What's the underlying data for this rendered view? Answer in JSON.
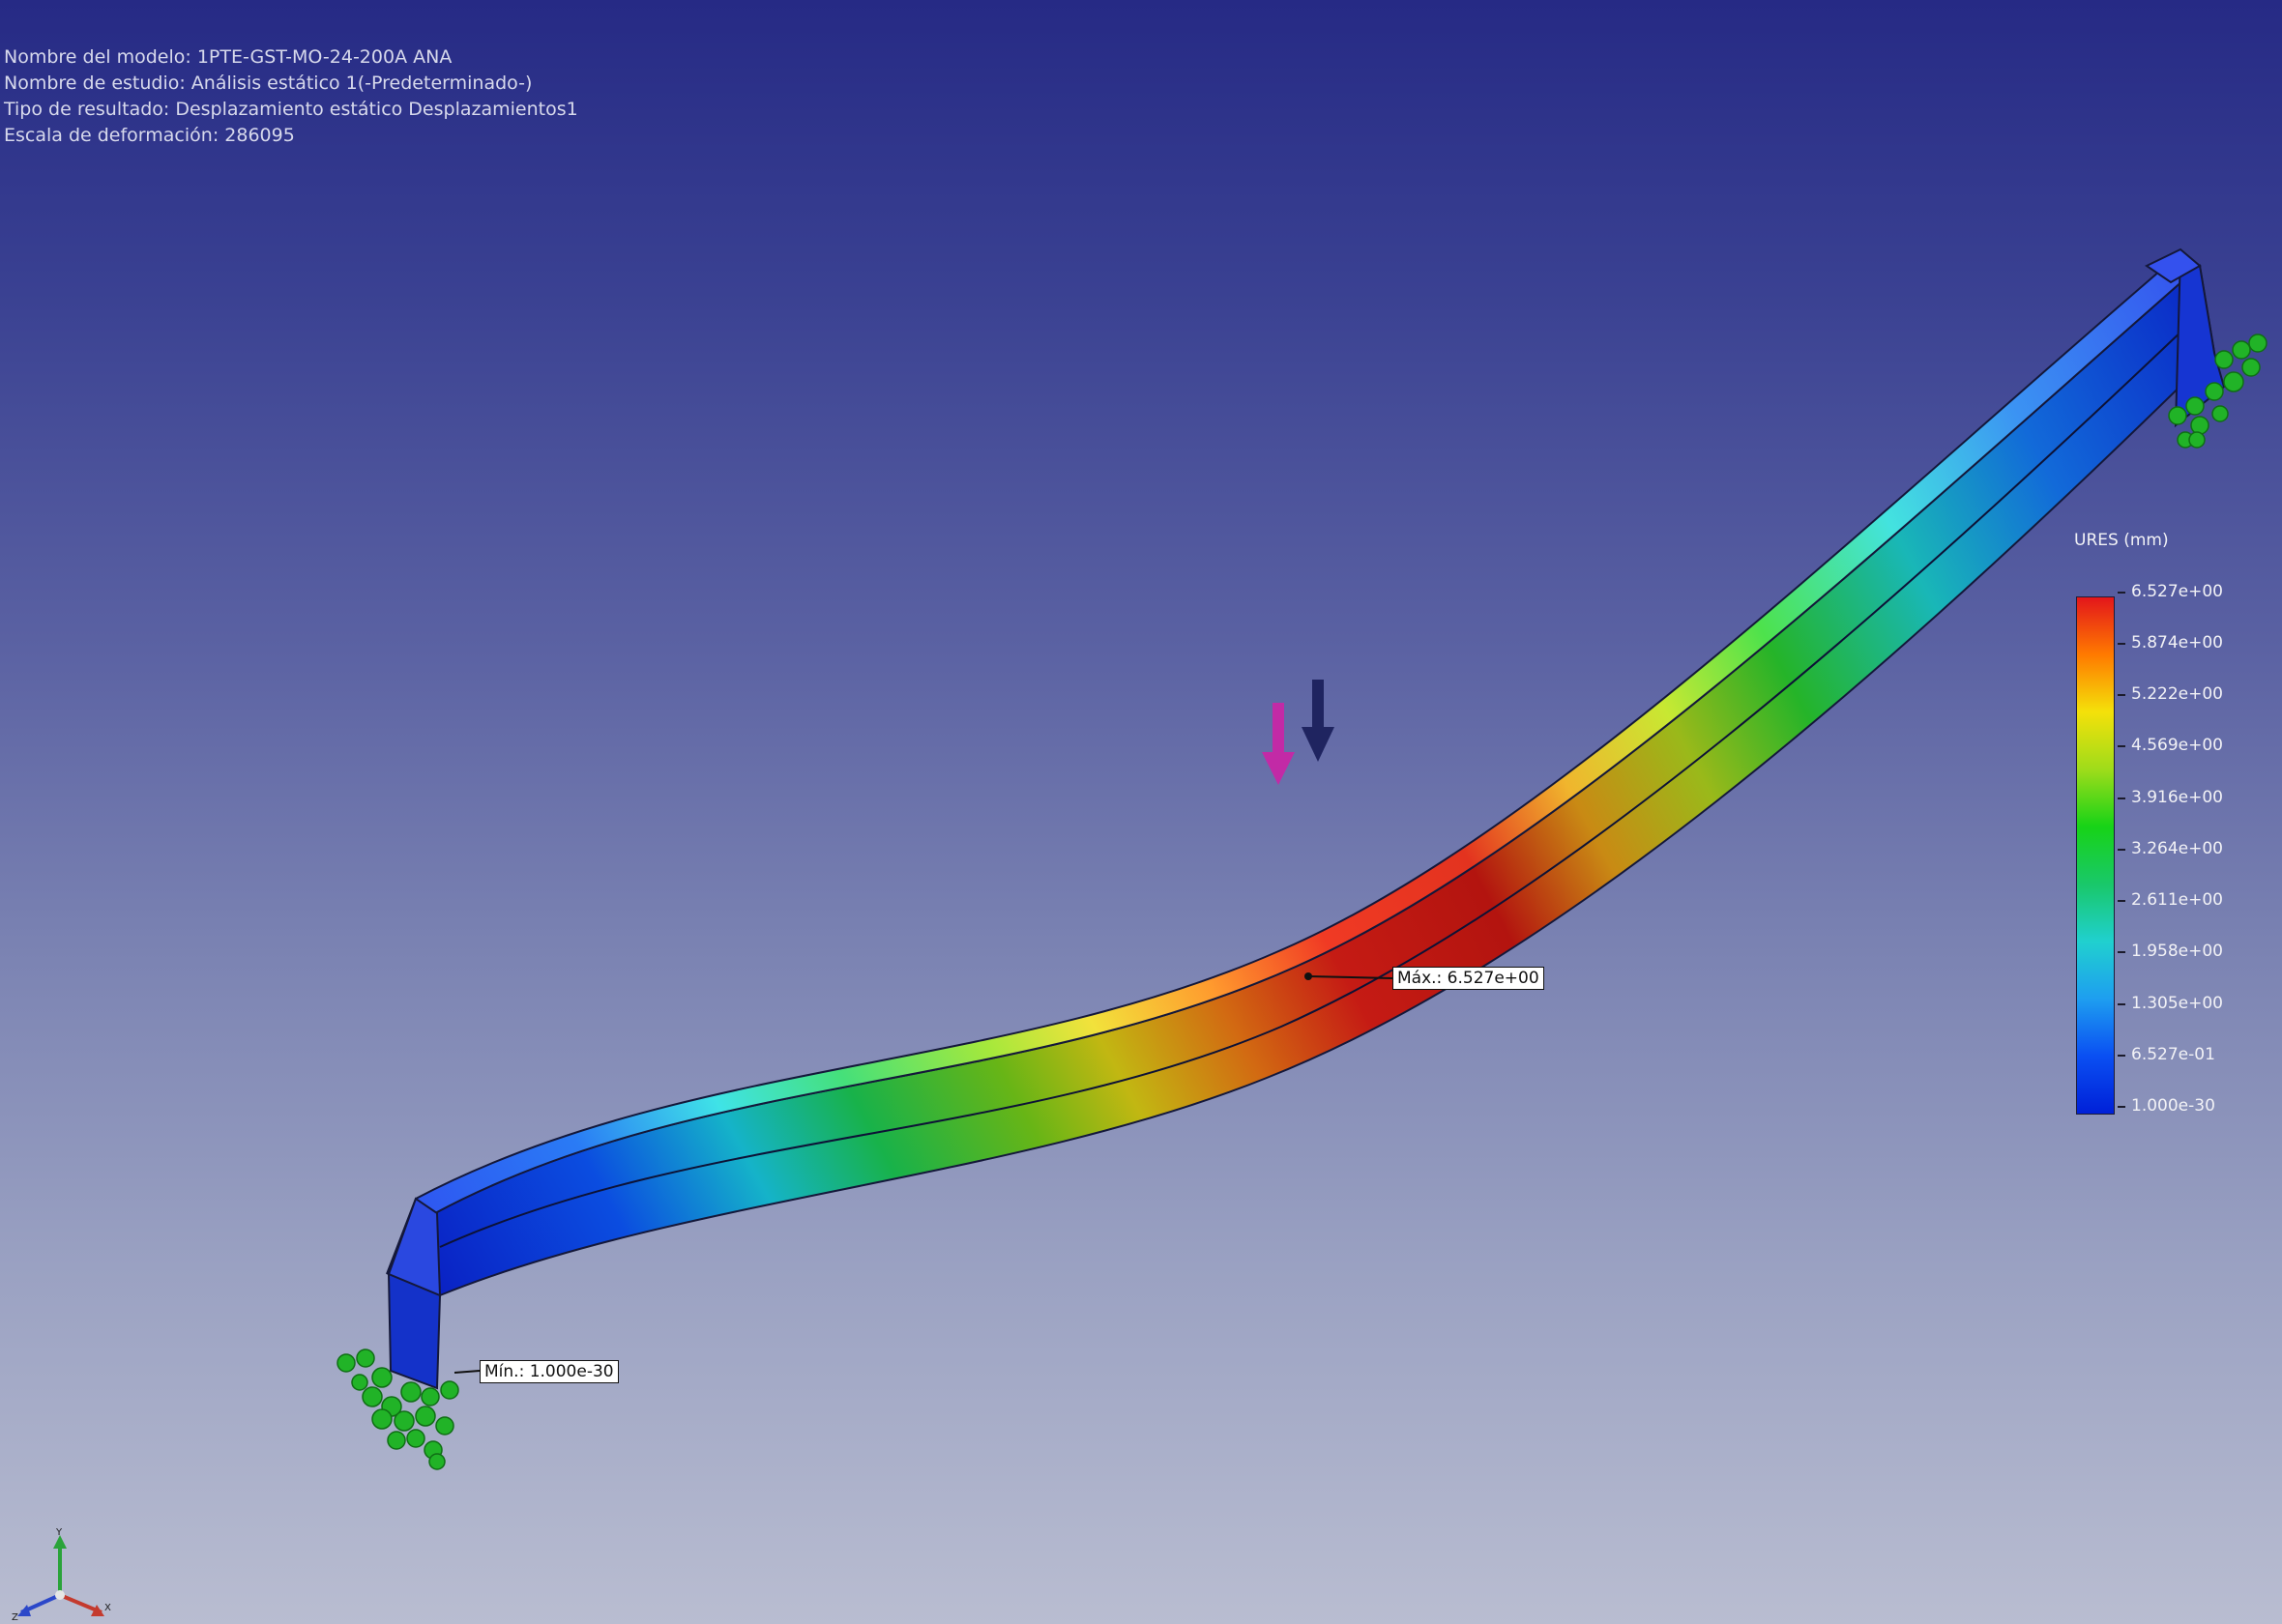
{
  "info": {
    "model_name": "Nombre del modelo: 1PTE-GST-MO-24-200A ANA",
    "study_name": "Nombre de estudio: Análisis estático 1(-Predeterminado-)",
    "result_type": "Tipo de resultado: Desplazamiento estático Desplazamientos1",
    "deform_scale": "Escala de deformación: 286095"
  },
  "legend": {
    "title": "URES (mm)",
    "ticks": [
      "6.527e+00",
      "5.874e+00",
      "5.222e+00",
      "4.569e+00",
      "3.916e+00",
      "3.264e+00",
      "2.611e+00",
      "1.958e+00",
      "1.305e+00",
      "6.527e-01",
      "1.000e-30"
    ],
    "colors": [
      "#e3161b",
      "#ff7a00",
      "#f4e10a",
      "#9fdc1a",
      "#17d317",
      "#19c86a",
      "#20d0cf",
      "#1e9ef0",
      "#0a4ff2",
      "#0020d8"
    ]
  },
  "probes": {
    "max_label": "Máx.: 6.527e+00",
    "min_label": "Mín.: 1.000e-30"
  },
  "load_arrow_colors": {
    "first": "#c22aa6",
    "second": "#1f2460"
  },
  "fixture_color": "#21b327",
  "triad": {
    "y_label": "Y",
    "x_label": "X",
    "z_label": "Z"
  }
}
